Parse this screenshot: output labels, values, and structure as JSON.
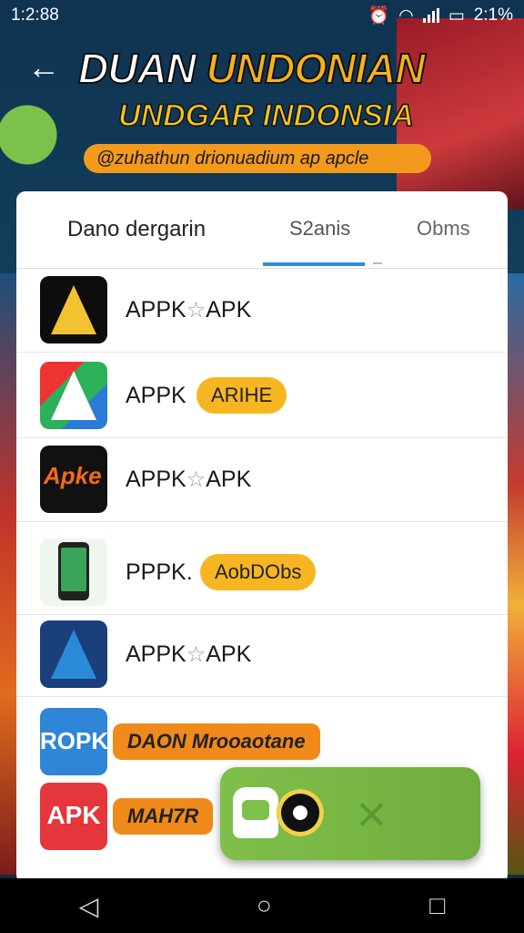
{
  "status_bar": {
    "time": "1:2:88",
    "battery": "2:1%"
  },
  "header": {
    "title_white": "DUAN",
    "title_yellow": "UNDONIAN",
    "subtitle": "UNDGAR INDONSIA",
    "tagline": "@zuhathun drionuadium ap apcle"
  },
  "tabs": [
    {
      "label": "Dano dergarin"
    },
    {
      "label": "S2anis"
    },
    {
      "label": "Obms"
    }
  ],
  "list": [
    {
      "text": "APPK",
      "suffix": "APK",
      "star": "☆",
      "pill": ""
    },
    {
      "text": "APPK",
      "suffix": "",
      "star": "",
      "pill": "ARIHE"
    },
    {
      "text": "APPK",
      "suffix": "APK",
      "star": "☆",
      "pill": ""
    },
    {
      "text": "PPPK.",
      "suffix": "",
      "star": "",
      "pill": "AobDObs"
    },
    {
      "text": "APPK",
      "suffix": "APK",
      "star": "☆",
      "pill": ""
    },
    {
      "text": "",
      "suffix": "",
      "star": "",
      "pill": "DAON Mrooaotane"
    },
    {
      "text": "",
      "suffix": "",
      "star": "",
      "pill": "MAH7R"
    }
  ],
  "icons": {
    "row6_label": "ROPK",
    "row7_label": "APK",
    "row3_script": "Apke"
  },
  "nav": {
    "back": "◁",
    "home": "○",
    "recents": "□"
  }
}
